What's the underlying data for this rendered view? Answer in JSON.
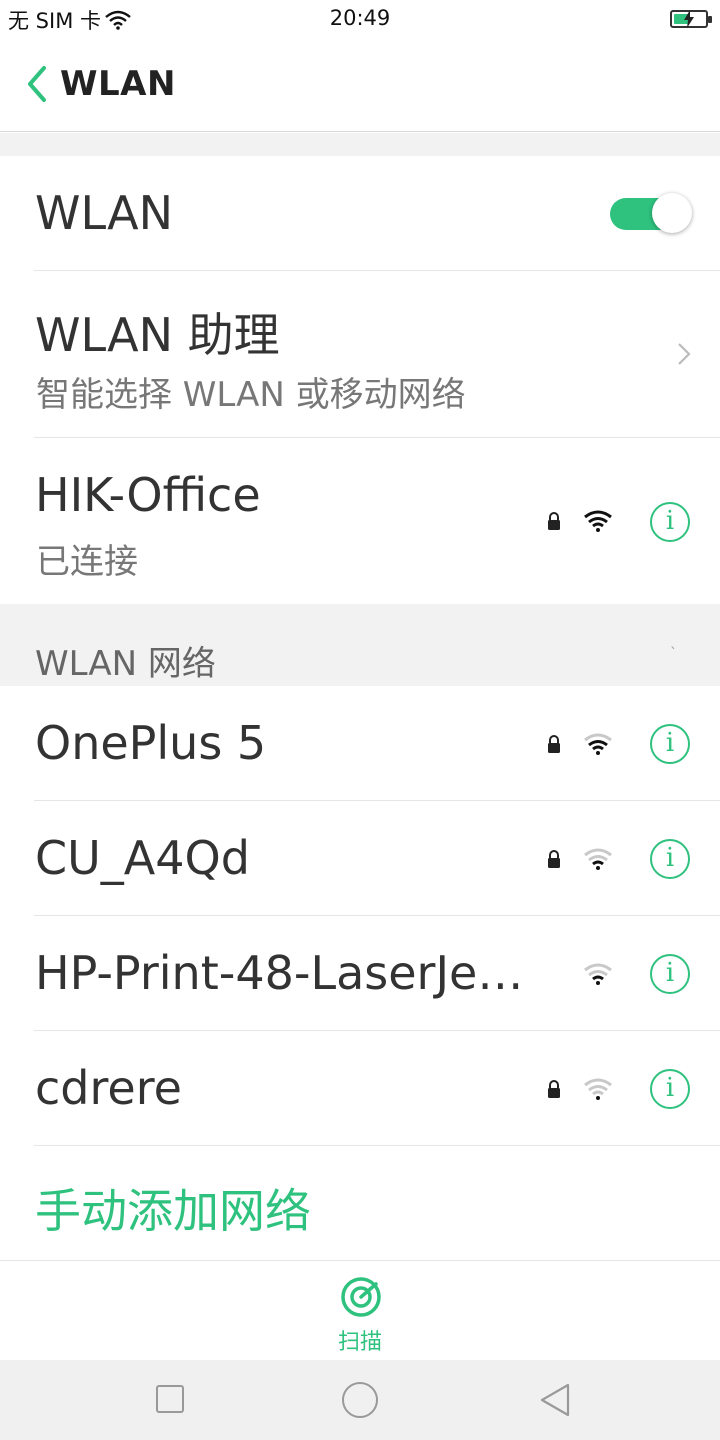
{
  "status_bar": {
    "carrier": "无 SIM 卡",
    "time": "20:49",
    "battery_level": 0.45,
    "icons": [
      "wifi-icon",
      "battery-charging-icon"
    ]
  },
  "header": {
    "title": "WLAN",
    "back_icon": "chevron-left-icon"
  },
  "wlan_toggle": {
    "label": "WLAN",
    "on": true
  },
  "assistant": {
    "title": "WLAN 助理",
    "subtitle": "智能选择 WLAN 或移动网络"
  },
  "connected": {
    "name": "HIK-Office",
    "status": "已连接",
    "secured": true,
    "signal": 4
  },
  "section": {
    "label": "WLAN 网络"
  },
  "networks": [
    {
      "name": "OnePlus 5",
      "secured": true,
      "signal": 3
    },
    {
      "name": "CU_A4Qd",
      "secured": true,
      "signal": 2
    },
    {
      "name": "HP-Print-48-LaserJe…",
      "secured": false,
      "signal": 2
    },
    {
      "name": "cdrere",
      "secured": true,
      "signal": 1
    }
  ],
  "add_network": {
    "label": "手动添加网络"
  },
  "bottom_bar": {
    "scan_label": "扫描"
  },
  "colors": {
    "accent": "#2ec27e",
    "text": "#333333",
    "subtext": "#777777",
    "divider": "#e6e6e6"
  }
}
